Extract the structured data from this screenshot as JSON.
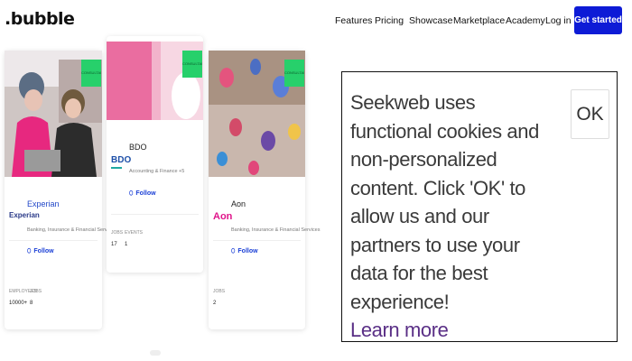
{
  "header": {
    "logo": ".bubble",
    "nav": [
      "Features",
      "Pricing",
      "Showcase",
      "Marketplace",
      "Academy"
    ],
    "login": "Log in",
    "cta": "Get started"
  },
  "cards": [
    {
      "badge": "CONSULTANCY",
      "logo_text": "Experian",
      "name": "Experian",
      "description": "Banking, Insurance & Financial Services +6",
      "follow": "Follow",
      "stats": [
        {
          "label": "EMPLOYEES",
          "value": "10000+"
        },
        {
          "label": "JOBS",
          "value": "8"
        }
      ]
    },
    {
      "badge": "CONSULTANCY",
      "logo_text": "BDO",
      "name": "BDO",
      "description": "Accounting & Finance +5",
      "follow": "Follow",
      "stats": [
        {
          "label": "JOBS",
          "value": "17"
        },
        {
          "label": "EVENTS",
          "value": "1"
        }
      ]
    },
    {
      "badge": "CONSULTANCY",
      "logo_text": "Aon",
      "name": "Aon",
      "description": "Banking, Insurance & Financial Services",
      "follow": "Follow",
      "stats": [
        {
          "label": "JOBS",
          "value": "2"
        }
      ]
    }
  ],
  "cookie": {
    "message": "Seekweb uses functional cookies and non-personalized content. Click 'OK' to allow us and our partners to use your data for the best experience!",
    "link": "Learn more",
    "ok": "OK"
  },
  "colors": {
    "cta": "#0d1bd6",
    "badge": "#27d06b",
    "link": "#5a2f86"
  }
}
